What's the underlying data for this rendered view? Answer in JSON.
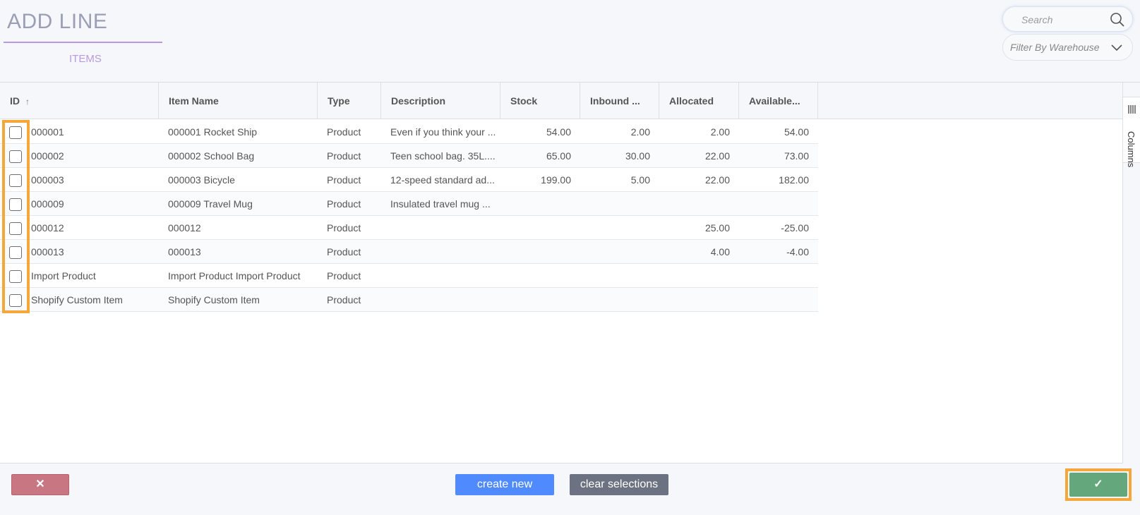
{
  "header": {
    "title": "ADD LINE",
    "tab_label": "ITEMS",
    "search_placeholder": "Search",
    "filter_placeholder": "Filter By Warehouse"
  },
  "grid": {
    "columns": [
      "ID",
      "Item Name",
      "Type",
      "Description",
      "Stock",
      "Inbound ...",
      "Allocated",
      "Available..."
    ],
    "sorted_column": "ID",
    "sort_direction": "ascending",
    "side_panel_label": "Columns",
    "rows": [
      {
        "id": "000001",
        "name": "000001 Rocket Ship",
        "type": "Product",
        "description": "Even if you think your ...",
        "stock": "54.00",
        "inbound": "2.00",
        "allocated": "2.00",
        "available": "54.00"
      },
      {
        "id": "000002",
        "name": "000002 School Bag",
        "type": "Product",
        "description": "Teen school bag. 35L....",
        "stock": "65.00",
        "inbound": "30.00",
        "allocated": "22.00",
        "available": "73.00"
      },
      {
        "id": "000003",
        "name": "000003 Bicycle",
        "type": "Product",
        "description": "12-speed standard ad...",
        "stock": "199.00",
        "inbound": "5.00",
        "allocated": "22.00",
        "available": "182.00"
      },
      {
        "id": "000009",
        "name": "000009 Travel Mug",
        "type": "Product",
        "description": "Insulated travel mug ...",
        "stock": "",
        "inbound": "",
        "allocated": "",
        "available": ""
      },
      {
        "id": "000012",
        "name": "000012",
        "type": "Product",
        "description": "",
        "stock": "",
        "inbound": "",
        "allocated": "25.00",
        "available": "-25.00"
      },
      {
        "id": "000013",
        "name": "000013",
        "type": "Product",
        "description": "",
        "stock": "",
        "inbound": "",
        "allocated": "4.00",
        "available": "-4.00"
      },
      {
        "id": "Import Product",
        "name": "Import Product Import Product",
        "type": "Product",
        "description": "",
        "stock": "",
        "inbound": "",
        "allocated": "",
        "available": ""
      },
      {
        "id": "Shopify Custom Item",
        "name": "Shopify Custom Item",
        "type": "Product",
        "description": "",
        "stock": "",
        "inbound": "",
        "allocated": "",
        "available": ""
      }
    ]
  },
  "footer": {
    "cancel_label": "✕",
    "create_label": "create new",
    "clear_label": "clear selections",
    "confirm_label": "✓"
  },
  "colors": {
    "accent": "#b99adf",
    "highlight": "#f5a73a",
    "cancel": "#c97683",
    "create": "#4f8bff",
    "clear": "#6c7281",
    "confirm": "#64a77d"
  }
}
